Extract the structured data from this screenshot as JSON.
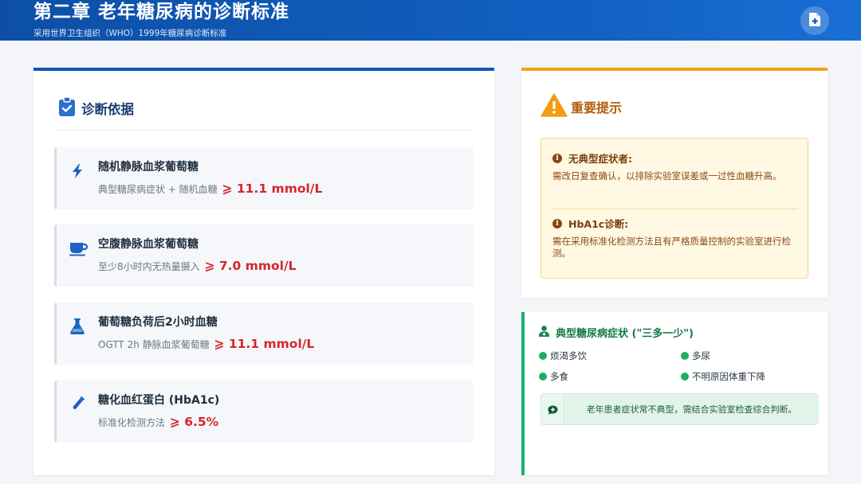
{
  "header": {
    "title": "第二章 老年糖尿病的诊断标准",
    "subtitle": "采用世界卫生组织（WHO）1999年糖尿病诊断标准",
    "doc_icon": "file-medical-icon"
  },
  "diagnosis": {
    "heading": "诊断依据",
    "heading_icon": "clipboard-check-icon",
    "items": [
      {
        "icon": "bolt-icon",
        "name": "随机静脉血浆葡萄糖",
        "desc": "典型糖尿病症状 + 随机血糖",
        "value": "⩾ 11.1 mmol/L"
      },
      {
        "icon": "coffee-cup-icon",
        "name": "空腹静脉血浆葡萄糖",
        "desc": "至少8小时内无热量摄入",
        "value": "⩾ 7.0 mmol/L"
      },
      {
        "icon": "flask-icon",
        "name": "葡萄糖负荷后2小时血糖",
        "desc": "OGTT 2h 静脉血浆葡萄糖",
        "value": "⩾ 11.1 mmol/L"
      },
      {
        "icon": "test-tube-icon",
        "name": "糖化血红蛋白 (HbA1c)",
        "desc": "标准化检测方法",
        "value": "⩾ 6.5%"
      }
    ]
  },
  "warning": {
    "heading": "重要提示",
    "heading_icon": "warning-triangle-icon",
    "notes": [
      {
        "title": "无典型症状者:",
        "text": "需改日复查确认，以排除实验室误差或一过性血糖升高。"
      },
      {
        "title": "HbA1c诊断:",
        "text": "需在采用标准化检测方法且有严格质量控制的实验室进行检测。"
      }
    ]
  },
  "symptoms": {
    "heading": "典型糖尿病症状 (\"三多一少\")",
    "heading_icon": "user-doctor-icon",
    "items": [
      "烦渴多饮",
      "多尿",
      "多食",
      "不明原因体重下降"
    ],
    "note": "老年患者症状常不典型，需结合实验室检查综合判断。",
    "note_icon": "comment-medical-icon"
  },
  "colors": {
    "primary": "#0d5ab8",
    "danger": "#d6262e",
    "warning": "#f2a51a",
    "success": "#19b26b"
  }
}
